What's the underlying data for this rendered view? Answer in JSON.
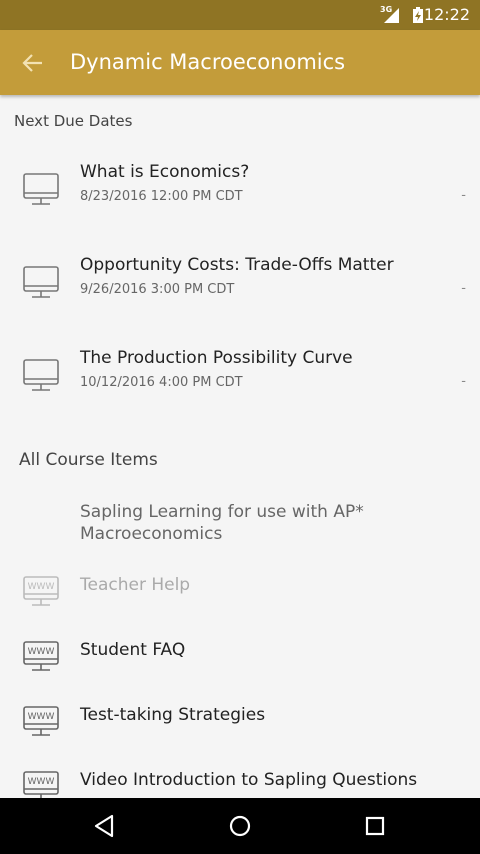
{
  "status": {
    "network": "3G",
    "time": "12:22"
  },
  "app_bar": {
    "title": "Dynamic Macroeconomics",
    "back_icon": "arrow-left-icon"
  },
  "colors": {
    "status_bar": "#8f7424",
    "app_bar": "#c39c3a",
    "background": "#f5f5f5",
    "nav_bar": "#000000"
  },
  "next_due": {
    "header": "Next Due Dates",
    "items": [
      {
        "title": "What is Economics?",
        "date": "8/23/2016 12:00 PM CDT",
        "score": "-",
        "icon": "computer-icon"
      },
      {
        "title": "Opportunity Costs: Trade-Offs Matter",
        "date": "9/26/2016 3:00 PM CDT",
        "score": "-",
        "icon": "computer-icon"
      },
      {
        "title": "The Production Possibility Curve",
        "date": "10/12/2016 4:00 PM CDT",
        "score": "-",
        "icon": "computer-icon"
      }
    ]
  },
  "all_items": {
    "header": "All Course Items",
    "items": [
      {
        "title": "Sapling Learning for use with AP* Macroeconomics",
        "icon": "none"
      },
      {
        "title": "Teacher Help",
        "icon": "web-computer-icon"
      },
      {
        "title": "Student FAQ",
        "icon": "web-computer-icon"
      },
      {
        "title": "Test-taking Strategies",
        "icon": "web-computer-icon"
      },
      {
        "title": "Video Introduction to Sapling Questions",
        "icon": "web-computer-icon"
      }
    ]
  },
  "nav": {
    "back": "nav-back-icon",
    "home": "nav-home-icon",
    "recents": "nav-recents-icon"
  }
}
